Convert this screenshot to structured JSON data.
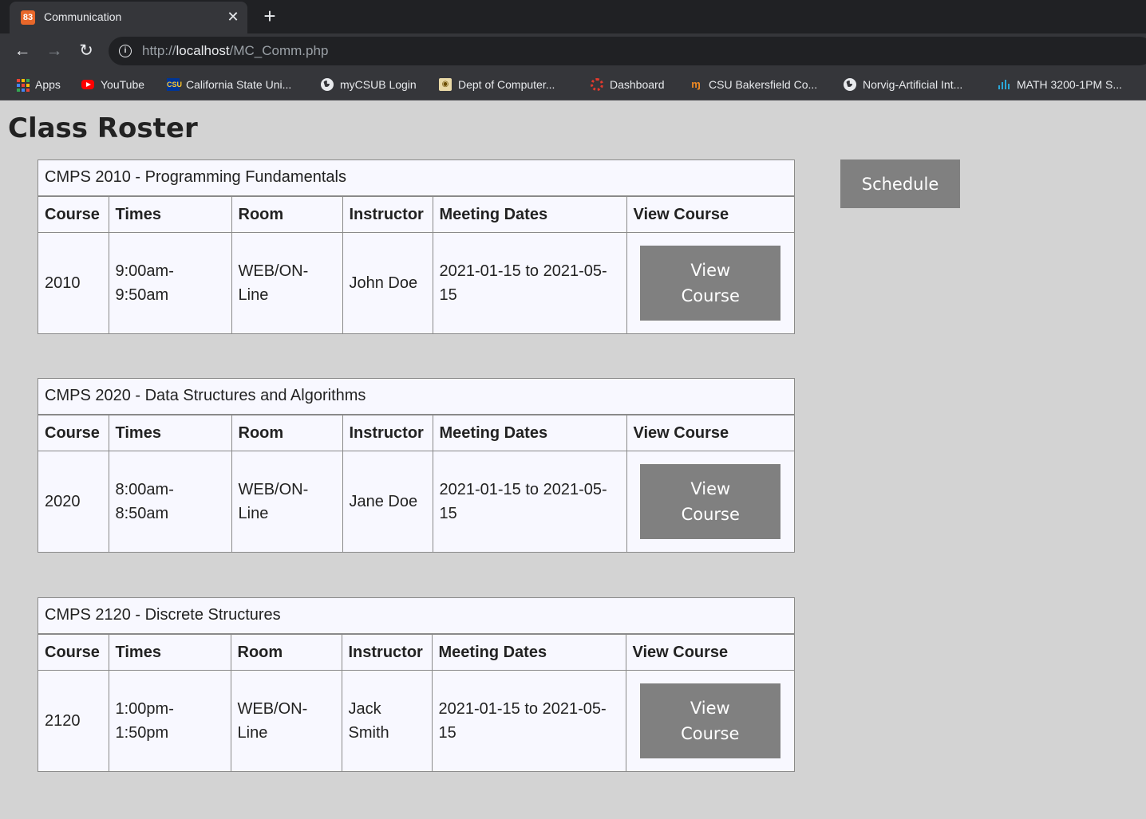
{
  "browser": {
    "tab_title": "Communication",
    "tab_favicon_text": "83",
    "url_scheme": "http://",
    "url_host": "localhost",
    "url_path": "/MC_Comm.php",
    "bookmarks": [
      {
        "label": "Apps",
        "icon": "apps-grid-icon"
      },
      {
        "label": "YouTube",
        "icon": "youtube-icon"
      },
      {
        "label": "California State Uni...",
        "icon": "csu-icon"
      },
      {
        "label": "myCSUB Login",
        "icon": "globe-icon"
      },
      {
        "label": "Dept of Computer...",
        "icon": "dept-seal-icon"
      },
      {
        "label": "Dashboard",
        "icon": "dashboard-icon"
      },
      {
        "label": "CSU Bakersfield Co...",
        "icon": "csub-icon"
      },
      {
        "label": "Norvig-Artificial Int...",
        "icon": "globe-icon"
      },
      {
        "label": "MATH 3200-1PM S...",
        "icon": "bar-chart-icon"
      }
    ]
  },
  "page": {
    "title": "Class Roster",
    "schedule_label": "Schedule",
    "view_course_label": "View Course",
    "headers": [
      "Course",
      "Times",
      "Room",
      "Instructor",
      "Meeting Dates",
      "View Course"
    ],
    "courses": [
      {
        "title": "CMPS 2010 - Programming Fundamentals",
        "course": "2010",
        "times": "9:00am-9:50am",
        "room": "WEB/ON-Line",
        "instructor": "John Doe",
        "meeting_dates": "2021-01-15 to 2021-05-15"
      },
      {
        "title": "CMPS 2020 - Data Structures and Algorithms",
        "course": "2020",
        "times": "8:00am-8:50am",
        "room": "WEB/ON-Line",
        "instructor": "Jane Doe",
        "meeting_dates": "2021-01-15 to 2021-05-15"
      },
      {
        "title": "CMPS 2120 - Discrete Structures",
        "course": "2120",
        "times": "1:00pm-1:50pm",
        "room": "WEB/ON-Line",
        "instructor": "Jack Smith",
        "meeting_dates": "2021-01-15 to 2021-05-15"
      }
    ]
  }
}
